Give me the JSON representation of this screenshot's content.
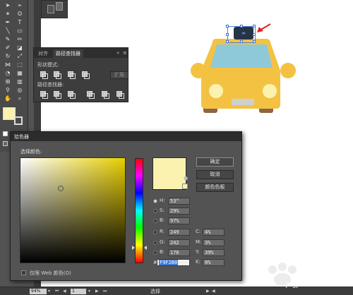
{
  "colors": {
    "fill": "#fbf2b0",
    "taxi_body": "#f4c242",
    "taxi_window": "#8ec9d9",
    "taxi_plate": "#cfcfcf",
    "taxi_wheels": "#8d6540",
    "sign": "#273444",
    "selection": "#3b73d6",
    "arrow": "#e02020"
  },
  "tools": {
    "icons": [
      "selection-arrow",
      "direct-selection-arrow",
      "magic-wand",
      "lasso",
      "pen",
      "text",
      "line-segment",
      "rectangle",
      "paintbrush",
      "pencil",
      "blob-brush",
      "eraser",
      "rotate",
      "scale",
      "width",
      "free-transform",
      "shape-builder",
      "perspective-grid",
      "mesh",
      "gradient",
      "eyedropper",
      "blend",
      "symbol-sprayer",
      "column-graph",
      "artboard",
      "slice",
      "hand",
      "zoom"
    ]
  },
  "pathfinder": {
    "tabs": [
      "对齐",
      "路径查找器"
    ],
    "menu_icon": "≡",
    "shape_modes_label": "形状模式:",
    "expand_label": "扩展",
    "pathfinders_label": "路径查找器:"
  },
  "picker": {
    "title": "拾色器",
    "select_label": "选择颜色:",
    "buttons": {
      "ok": "确定",
      "cancel": "取消",
      "swatches": "颜色色板"
    },
    "hsb": [
      {
        "label": "H:",
        "value": "53°",
        "unit": "",
        "selected": true
      },
      {
        "label": "S:",
        "value": "29%",
        "unit": "",
        "selected": false
      },
      {
        "label": "B:",
        "value": "97%",
        "unit": "",
        "selected": false
      }
    ],
    "rgb": [
      {
        "label": "R:",
        "value": "249"
      },
      {
        "label": "G:",
        "value": "242"
      },
      {
        "label": "B:",
        "value": "176"
      }
    ],
    "cmyk": [
      {
        "label": "C:",
        "value": "4%"
      },
      {
        "label": "M:",
        "value": "3%"
      },
      {
        "label": "Y:",
        "value": "39%"
      },
      {
        "label": "K:",
        "value": "0%"
      }
    ],
    "hex_label": "#",
    "hex_value": "F9F2B0",
    "websafe_label": "仅限 Web 颜色(O)"
  },
  "statusbar": {
    "zoom": "94%",
    "page": "1",
    "tool": "选择"
  },
  "watermark": "jingyan.baidu.com"
}
